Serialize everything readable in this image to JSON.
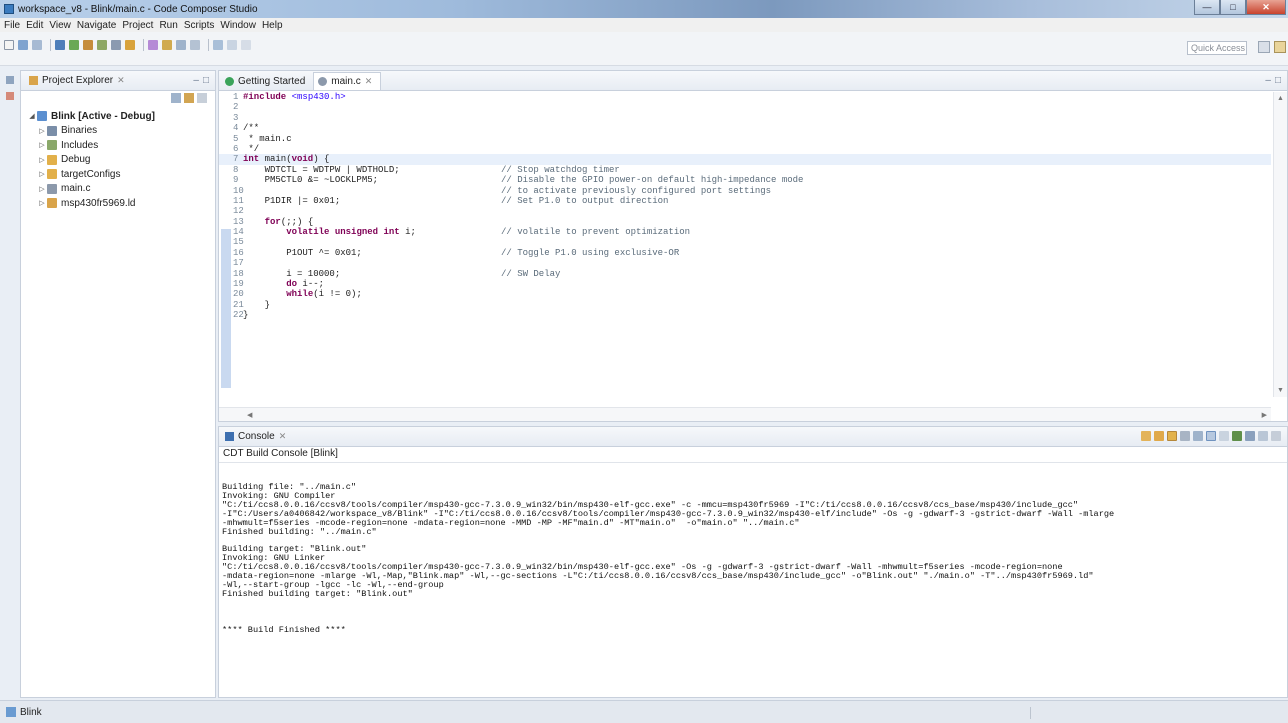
{
  "window": {
    "title": "workspace_v8 - Blink/main.c - Code Composer Studio",
    "min_glyph": "—",
    "max_glyph": "□",
    "close_glyph": "✕"
  },
  "menu": [
    "File",
    "Edit",
    "View",
    "Navigate",
    "Project",
    "Run",
    "Scripts",
    "Window",
    "Help"
  ],
  "toolbar": {
    "quick_access_placeholder": "Quick Access"
  },
  "explorer": {
    "tab_label": "Project Explorer",
    "close_glyph": "✕",
    "tree": [
      {
        "label": "Blink  [Active - Debug]",
        "bold": true,
        "indent": 0,
        "arrow": "◢",
        "icon_color": "#5b8fd0"
      },
      {
        "label": "Binaries",
        "bold": false,
        "indent": 1,
        "arrow": "▷",
        "icon_color": "#7a8ea8"
      },
      {
        "label": "Includes",
        "bold": false,
        "indent": 1,
        "arrow": "▷",
        "icon_color": "#8aa86a"
      },
      {
        "label": "Debug",
        "bold": false,
        "indent": 1,
        "arrow": "▷",
        "icon_color": "#e2b04a"
      },
      {
        "label": "targetConfigs",
        "bold": false,
        "indent": 1,
        "arrow": "▷",
        "icon_color": "#e2b04a"
      },
      {
        "label": "main.c",
        "bold": false,
        "indent": 1,
        "arrow": "▷",
        "icon_color": "#8c99ab"
      },
      {
        "label": "msp430fr5969.ld",
        "bold": false,
        "indent": 1,
        "arrow": "▷",
        "icon_color": "#d9a44a"
      }
    ]
  },
  "editor": {
    "tabs": [
      {
        "label": "Getting Started",
        "active": false,
        "icon_color": "#3aa35a",
        "closable": false
      },
      {
        "label": "main.c",
        "active": true,
        "icon_color": "#8c99ab",
        "closable": true
      }
    ],
    "close_glyph": "✕",
    "lines": [
      {
        "n": "1",
        "code": "#include <msp430.h>",
        "comment": ""
      },
      {
        "n": "2",
        "code": "",
        "comment": ""
      },
      {
        "n": "3",
        "code": "",
        "comment": ""
      },
      {
        "n": "4",
        "code": "/**",
        "comment": ""
      },
      {
        "n": "5",
        "code": " * main.c",
        "comment": ""
      },
      {
        "n": "6",
        "code": " */",
        "comment": ""
      },
      {
        "n": "7",
        "code": "int main(void) {",
        "comment": ""
      },
      {
        "n": "8",
        "code": "    WDTCTL = WDTPW | WDTHOLD;",
        "comment": "// Stop watchdog timer"
      },
      {
        "n": "9",
        "code": "    PM5CTL0 &= ~LOCKLPM5;",
        "comment": "// Disable the GPIO power-on default high-impedance mode"
      },
      {
        "n": "10",
        "code": "",
        "comment": "// to activate previously configured port settings"
      },
      {
        "n": "11",
        "code": "    P1DIR |= 0x01;",
        "comment": "// Set P1.0 to output direction"
      },
      {
        "n": "12",
        "code": "",
        "comment": ""
      },
      {
        "n": "13",
        "code": "    for(;;) {",
        "comment": ""
      },
      {
        "n": "14",
        "code": "        volatile unsigned int i;",
        "comment": "// volatile to prevent optimization"
      },
      {
        "n": "15",
        "code": "",
        "comment": ""
      },
      {
        "n": "16",
        "code": "        P1OUT ^= 0x01;",
        "comment": "// Toggle P1.0 using exclusive-OR"
      },
      {
        "n": "17",
        "code": "",
        "comment": ""
      },
      {
        "n": "18",
        "code": "        i = 10000;",
        "comment": "// SW Delay"
      },
      {
        "n": "19",
        "code": "        do i--;",
        "comment": ""
      },
      {
        "n": "20",
        "code": "        while(i != 0);",
        "comment": ""
      },
      {
        "n": "21",
        "code": "    }",
        "comment": ""
      },
      {
        "n": "22",
        "code": "}",
        "comment": ""
      }
    ]
  },
  "console": {
    "tab_label": "Console",
    "close_glyph": "✕",
    "subtitle": "CDT Build Console [Blink]",
    "lines": [
      "",
      "",
      "Building file: \"../main.c\"",
      "Invoking: GNU Compiler",
      "\"C:/ti/ccs8.0.0.16/ccsv8/tools/compiler/msp430-gcc-7.3.0.9_win32/bin/msp430-elf-gcc.exe\" -c -mmcu=msp430fr5969 -I\"C:/ti/ccs8.0.0.16/ccsv8/ccs_base/msp430/include_gcc\"",
      "-I\"C:/Users/a0406842/workspace_v8/Blink\" -I\"C:/ti/ccs8.0.0.16/ccsv8/tools/compiler/msp430-gcc-7.3.0.9_win32/msp430-elf/include\" -Os -g -gdwarf-3 -gstrict-dwarf -Wall -mlarge",
      "-mhwmult=f5series -mcode-region=none -mdata-region=none -MMD -MP -MF\"main.d\" -MT\"main.o\"  -o\"main.o\" \"../main.c\"",
      "Finished building: \"../main.c\"",
      "",
      "Building target: \"Blink.out\"",
      "Invoking: GNU Linker",
      "\"C:/ti/ccs8.0.0.16/ccsv8/tools/compiler/msp430-gcc-7.3.0.9_win32/bin/msp430-elf-gcc.exe\" -Os -g -gdwarf-3 -gstrict-dwarf -Wall -mhwmult=f5series -mcode-region=none",
      "-mdata-region=none -mlarge -Wl,-Map,\"Blink.map\" -Wl,--gc-sections -L\"C:/ti/ccs8.0.0.16/ccsv8/ccs_base/msp430/include_gcc\" -o\"Blink.out\" \"./main.o\" -T\"../msp430fr5969.ld\"",
      "-Wl,--start-group -lgcc -lc -Wl,--end-group",
      "Finished building target: \"Blink.out\"",
      "",
      "",
      "",
      "**** Build Finished ****"
    ]
  },
  "status": {
    "text": "Blink"
  }
}
